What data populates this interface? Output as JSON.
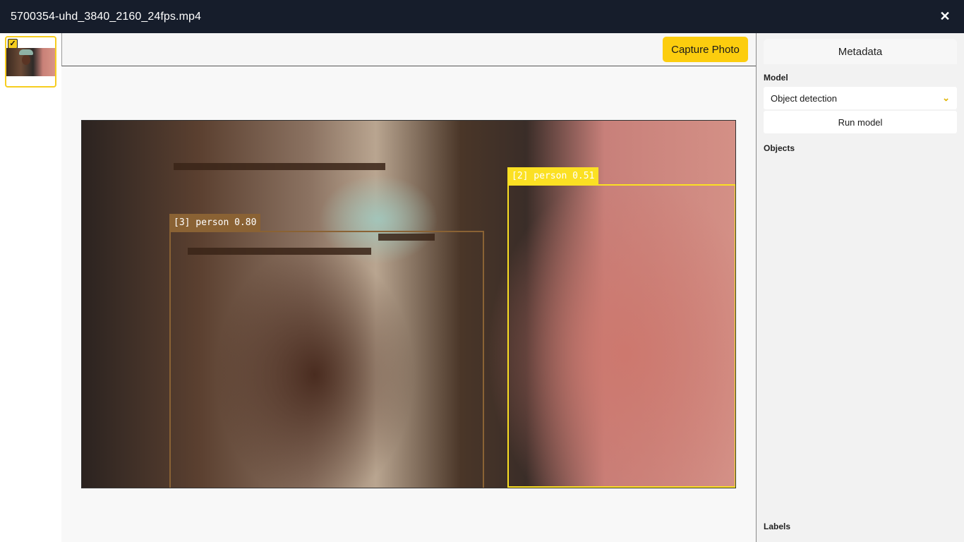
{
  "window": {
    "title": "5700354-uhd_3840_2160_24fps.mp4",
    "close_glyph": "✕"
  },
  "thumbnails": [
    {
      "selected": true,
      "check_glyph": "✓",
      "icon": "video-thumbnail"
    }
  ],
  "toolbar": {
    "capture_label": "Capture Photo",
    "accent_color": "#fccd0e"
  },
  "detections": [
    {
      "id": "3",
      "label": "[3] person 0.80",
      "class": "person",
      "score": 0.8,
      "color": "#8a6234"
    },
    {
      "id": "2",
      "label": "[2] person 0.51",
      "class": "person",
      "score": 0.51,
      "color": "#fbe023"
    }
  ],
  "sidebar": {
    "tab_label": "Metadata",
    "model_label": "Model",
    "model_value": "Object detection",
    "chevron_icon": "chevron-down-icon",
    "run_label": "Run model",
    "objects_label": "Objects",
    "labels_label": "Labels"
  }
}
